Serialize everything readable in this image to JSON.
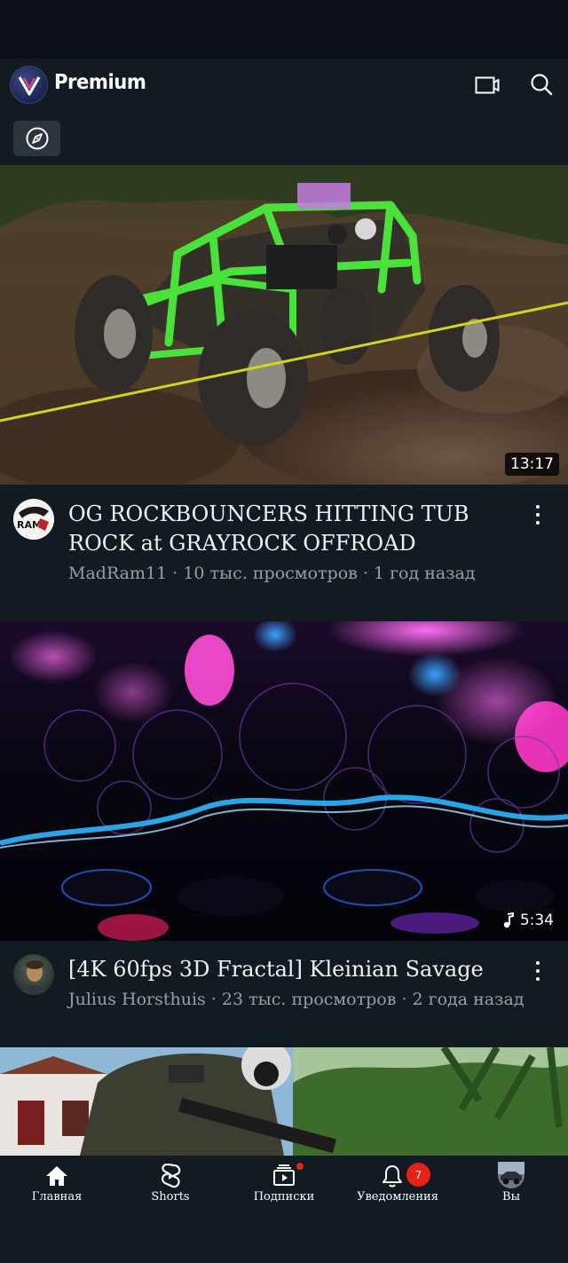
{
  "header": {
    "brand": "Premium",
    "icons": [
      "cast-icon",
      "search-icon"
    ],
    "chip_icon": "compass-icon"
  },
  "videos": [
    {
      "title": "OG ROCKBOUNCERS HITTING TUB ROCK at GRAYROCK OFFROAD",
      "meta": "MadRam11 · 10 тыс. просмотров · 1 год назад",
      "duration": "13:17"
    },
    {
      "title": "[4K 60fps 3D Fractal] Kleinian Savage",
      "meta": "Julius Horsthuis · 23 тыс. просмотров · 2 года назад",
      "duration": "5:34"
    }
  ],
  "avatar_text": "RAM",
  "nav": [
    {
      "label": "Главная",
      "icon": "home-icon"
    },
    {
      "label": "Shorts",
      "icon": "shorts-icon"
    },
    {
      "label": "Подписки",
      "icon": "subscriptions-icon"
    },
    {
      "label": "Уведомления",
      "icon": "bell-icon",
      "badge": "7"
    },
    {
      "label": "Вы",
      "icon": "profile-avatar"
    }
  ],
  "colors": {
    "background": "#111b21",
    "accent_red": "#e62117"
  }
}
